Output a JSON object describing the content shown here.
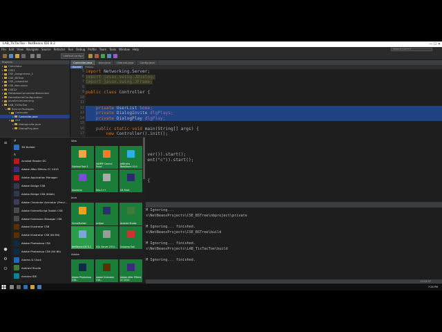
{
  "window": {
    "title": "LAB_TicTacToe - NetBeans IDE 8.2",
    "controls": "—  ☐  ✕"
  },
  "menu": [
    "File",
    "Edit",
    "View",
    "Navigate",
    "Source",
    "Refactor",
    "Run",
    "Debug",
    "Profile",
    "Team",
    "Tools",
    "Window",
    "Help"
  ],
  "search_placeholder": "Search (Ctrl+I)",
  "config_select": "<default config>",
  "projects_panel": {
    "header": "Projects",
    "items": [
      {
        "label": "Calculator",
        "depth": 0
      },
      {
        "label": "CSE2",
        "depth": 0
      },
      {
        "label": "CSE_Assignment_1",
        "depth": 0
      },
      {
        "label": "CSE_BSTree",
        "depth": 0
      },
      {
        "label": "CSE_LinkedList",
        "depth": 0
      },
      {
        "label": "CSE_Recursion",
        "depth": 0
      },
      {
        "label": "CSE22",
        "depth": 0
      },
      {
        "label": "DatabaseConnectionRestricted",
        "depth": 0
      },
      {
        "label": "DemoKernelConfiguration",
        "depth": 0
      },
      {
        "label": "JavaServerLearning",
        "depth": 0
      },
      {
        "label": "LAB_TicTacToe",
        "depth": 0
      },
      {
        "label": "Source Packages",
        "depth": 1
      },
      {
        "label": "Controller",
        "depth": 2
      },
      {
        "label": "Controller.java",
        "depth": 3,
        "selected": true
      },
      {
        "label": "GUI",
        "depth": 2
      },
      {
        "label": "DialogInvite.java",
        "depth": 3
      },
      {
        "label": "DialogPlay.java",
        "depth": 3
      }
    ]
  },
  "editor": {
    "tabs": [
      {
        "label": "Controller.java",
        "active": true
      },
      {
        "label": "User.java",
        "active": false
      },
      {
        "label": "UserList.java",
        "active": false
      },
      {
        "label": "Config.java",
        "active": false
      }
    ],
    "subtabs": [
      "Source",
      "History"
    ],
    "lines": [
      {
        "num": "5",
        "parts": [
          {
            "t": "import ",
            "c": "kw"
          },
          {
            "t": "Networking.Server;",
            "c": "cm"
          }
        ]
      },
      {
        "num": "6",
        "parts": [
          {
            "t": "import javax.swing.JDialog;",
            "c": "dim"
          }
        ]
      },
      {
        "num": "7",
        "parts": [
          {
            "t": "import javax.swing.JFrame;",
            "c": "dim"
          }
        ]
      },
      {
        "num": "8",
        "parts": []
      },
      {
        "num": "9",
        "parts": [
          {
            "t": "public class ",
            "c": "kw"
          },
          {
            "t": "Controller {",
            "c": "cm"
          }
        ]
      },
      {
        "num": "10",
        "parts": []
      },
      {
        "num": "11",
        "parts": []
      },
      {
        "num": "12",
        "parts": [
          {
            "t": "    private ",
            "c": "kw"
          },
          {
            "t": "UserList ",
            "c": "cm"
          },
          {
            "t": "home;",
            "c": "fd"
          }
        ],
        "hl": true
      },
      {
        "num": "13",
        "parts": [
          {
            "t": "    private ",
            "c": "kw"
          },
          {
            "t": "DialogInvite ",
            "c": "cm"
          },
          {
            "t": "dlgPlays;",
            "c": "fd"
          }
        ],
        "hl": true
      },
      {
        "num": "14",
        "parts": [
          {
            "t": "    private ",
            "c": "kw"
          },
          {
            "t": "DialogPlay ",
            "c": "cm"
          },
          {
            "t": "dlgPlay;",
            "c": "fd"
          }
        ],
        "hl": true
      },
      {
        "num": "15",
        "parts": []
      },
      {
        "num": "16",
        "parts": [
          {
            "t": "    public static void ",
            "c": "kw"
          },
          {
            "t": "main(String[] args) {",
            "c": "cm"
          }
        ]
      },
      {
        "num": "17",
        "parts": [
          {
            "t": "        new ",
            "c": "kw"
          },
          {
            "t": "Controller().init();",
            "c": "cm"
          }
        ]
      },
      {
        "num": "18",
        "parts": [
          {
            "t": "    }",
            "c": "cm"
          }
        ]
      },
      {
        "num": "19",
        "parts": []
      },
      {
        "num": "20",
        "parts": []
      },
      {
        "num": "21",
        "parts": [
          {
            "t": "                        ver()).start();",
            "c": "cm"
          }
        ]
      },
      {
        "num": "22",
        "parts": [
          {
            "t": "                        ent(\"c\")).start();",
            "c": "cm"
          }
        ]
      },
      {
        "num": "23",
        "parts": []
      },
      {
        "num": "24",
        "parts": []
      },
      {
        "num": "25",
        "parts": []
      },
      {
        "num": "26",
        "parts": [
          {
            "t": "                        {",
            "c": "cm"
          }
        ]
      }
    ]
  },
  "output": {
    "header": "Output - DeleteProjects",
    "lines": [
      "PM Ignoring...",
      "ts\\NetBeansProjects\\CSE_BSTree\\nbproject\\private",
      "",
      "PM Ignoring... finished.",
      "ts\\NetBeansProjects\\CSE_BSTree\\build",
      "",
      "PM Ignoring... finished.",
      "ts\\NetBeansProjects\\LAB_TicTacToe\\build",
      "",
      "PM Ignoring... finished."
    ]
  },
  "status_pos": "12:53:37",
  "start_menu": {
    "letters": [
      "#",
      "A"
    ],
    "apps": [
      {
        "label": "3D Builder",
        "color": "#2a6fbd",
        "letter": "#"
      },
      {
        "label": "Acrobat Reader DC",
        "color": "#b51c1c"
      },
      {
        "label": "Adobe After Effects CC 2015",
        "color": "#3b2a7d"
      },
      {
        "label": "Adobe Application Manager",
        "color": "#c4161c"
      },
      {
        "label": "Adobe Bridge CS6",
        "color": "#2f3b4c"
      },
      {
        "label": "Adobe Bridge CS6 (64bit)",
        "color": "#2f3b4c"
      },
      {
        "label": "Adobe Character Animator (Previ...",
        "color": "#3c3c5c"
      },
      {
        "label": "Adobe ExtendScript Toolkit CS6",
        "color": "#4a4a4a"
      },
      {
        "label": "Adobe Extension Manager CS6",
        "color": "#4a4a4a"
      },
      {
        "label": "Adobe Illustrator CS6",
        "color": "#5a3000"
      },
      {
        "label": "Adobe Illustrator CS6 (64 Bit)",
        "color": "#5a3000"
      },
      {
        "label": "Adobe Photoshop CS6",
        "color": "#0d2b47"
      },
      {
        "label": "Adobe Photoshop CS6 (64 Bit)",
        "color": "#0d2b47"
      },
      {
        "label": "Alarms & Clock",
        "color": "#1e6ab8"
      },
      {
        "label": "Android Studio",
        "color": "#3e7b3b"
      },
      {
        "label": "Arduino IDE",
        "color": "#00878f"
      }
    ],
    "groups": [
      "Web",
      "Java",
      "Adobe"
    ],
    "tiles": [
      {
        "label": "Sublime Text 3",
        "bg": "#1b7d3a",
        "ic": "#f2a34a"
      },
      {
        "label": "XAMPP Control Panel",
        "bg": "#1b7d3a",
        "ic": "#f57c20"
      },
      {
        "label": "JetBrains WebStorm 10.0",
        "bg": "#1b7d3a",
        "ic": "#2db0e6"
      },
      {
        "label": "Insomnia",
        "bg": "#1b7d3a",
        "ic": "#7b4fd4"
      },
      {
        "label": "Dev-C++",
        "bg": "#1b7d3a",
        "ic": "#aaaaaa"
      },
      {
        "label": "Git Shell",
        "bg": "#1b7d3a",
        "ic": "#2b2b6b"
      },
      {
        "label": "SceneBuilder",
        "bg": "#1b7d3a",
        "ic": "#f0a020"
      },
      {
        "label": "eclipse",
        "bg": "#1b7d3a",
        "ic": "#2b2f6b"
      },
      {
        "label": "Android Studio",
        "bg": "#1b7d3a",
        "ic": "#3e7b3b"
      },
      {
        "label": "NetBeans IDE 8.2",
        "bg": "#2a9c4a",
        "ic": "#7aa7d4"
      },
      {
        "label": "SQL Server 2014...",
        "bg": "#1b7d3a",
        "ic": "#9a9a9a"
      },
      {
        "label": "Snipping Tool",
        "bg": "#1b7d3a",
        "ic": "#cc3333"
      },
      {
        "label": "Adobe Photoshop CS6...",
        "bg": "#1b7d3a",
        "ic": "#0d2b47"
      },
      {
        "label": "Adobe Illustrator CS6...",
        "bg": "#1b7d3a",
        "ic": "#5a3000"
      },
      {
        "label": "Adobe After Effects CC 2015",
        "bg": "#1b7d3a",
        "ic": "#3b2a7d"
      }
    ]
  },
  "taskbar": {
    "clock": "7:26 PM"
  }
}
